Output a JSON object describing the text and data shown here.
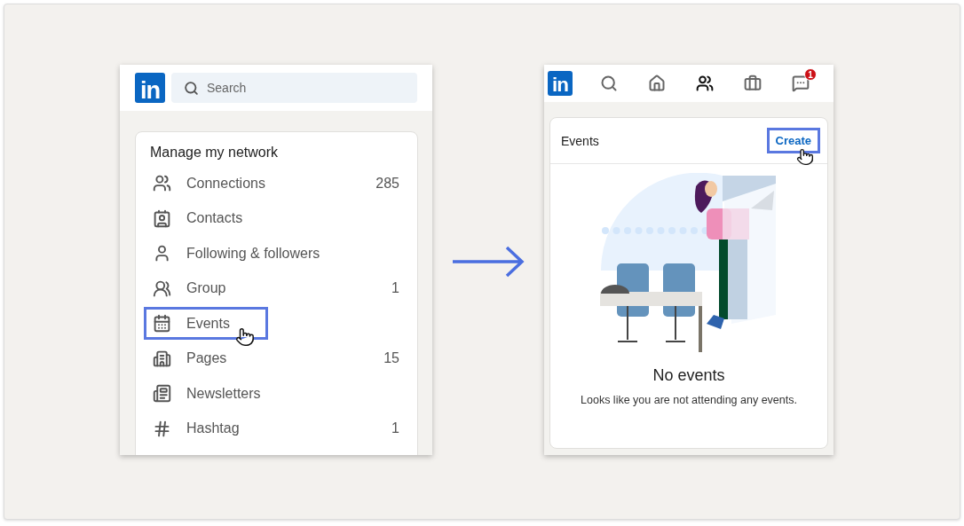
{
  "left_screen": {
    "logo": "in",
    "search": {
      "placeholder": "Search"
    },
    "card": {
      "title": "Manage my network",
      "items": [
        {
          "kind": "connections",
          "label": "Connections",
          "count": "285",
          "selected": false
        },
        {
          "kind": "contacts",
          "label": "Contacts",
          "selected": false
        },
        {
          "kind": "following",
          "label": "Following & followers",
          "selected": false
        },
        {
          "kind": "groups",
          "label": "Group",
          "count": "1",
          "selected": false
        },
        {
          "kind": "events",
          "label": "Events",
          "selected": true
        },
        {
          "kind": "pages",
          "label": "Pages",
          "count": "15",
          "selected": false
        },
        {
          "kind": "newsletters",
          "label": "Newsletters",
          "selected": false
        },
        {
          "kind": "hashtag",
          "label": "Hashtag",
          "count": "1",
          "selected": false
        }
      ]
    }
  },
  "right_screen": {
    "logo": "in",
    "nav": [
      {
        "kind": "search",
        "selected": false
      },
      {
        "kind": "home",
        "selected": false
      },
      {
        "kind": "network",
        "selected": true
      },
      {
        "kind": "jobs",
        "selected": false
      },
      {
        "kind": "messaging",
        "selected": false,
        "badge": "1"
      }
    ],
    "events_card": {
      "title": "Events",
      "create_button": {
        "label": "Create",
        "highlighted": true
      },
      "empty_title": "No events",
      "empty_text": "Looks like you are not attending any events."
    }
  }
}
